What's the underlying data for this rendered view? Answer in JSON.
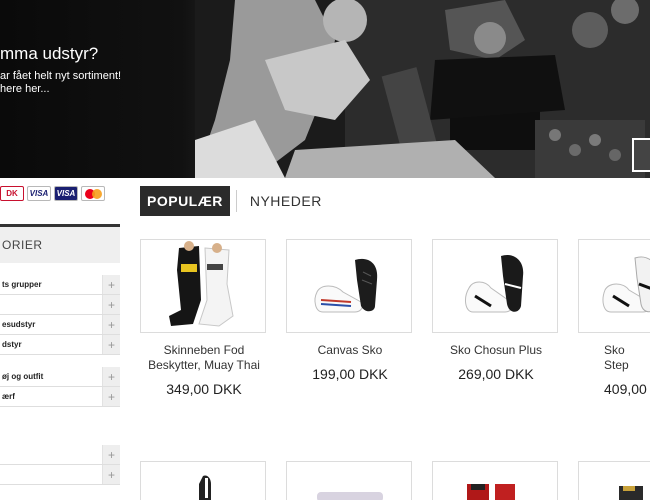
{
  "banner": {
    "heading": "mma udstyr?",
    "sub_line1": "ar fået helt nyt sortiment!",
    "sub_line2": "here her..."
  },
  "payments": {
    "cards": [
      "DK",
      "VISA",
      "VISA",
      "MasterCard"
    ]
  },
  "sidebar": {
    "heading": "ORIER",
    "groups": [
      [
        "ts grupper",
        "",
        "esudstyr",
        "dstyr"
      ],
      [
        "øj og outfit",
        "ærf"
      ],
      [
        "",
        ""
      ]
    ]
  },
  "tabs": {
    "active": "POPULÆR",
    "inactive": "NYHEDER"
  },
  "products": [
    {
      "name": "Skinneben Fod Beskytter, Muay Thai",
      "price": "349,00 DKK"
    },
    {
      "name": "Canvas Sko",
      "price": "199,00 DKK"
    },
    {
      "name": "Sko Chosun Plus",
      "price": "269,00 DKK"
    },
    {
      "name": "Sko Step",
      "price": "409,00"
    }
  ],
  "colors": {
    "tab_active_bg": "#2b2b2b",
    "border": "#dcdcdc"
  }
}
